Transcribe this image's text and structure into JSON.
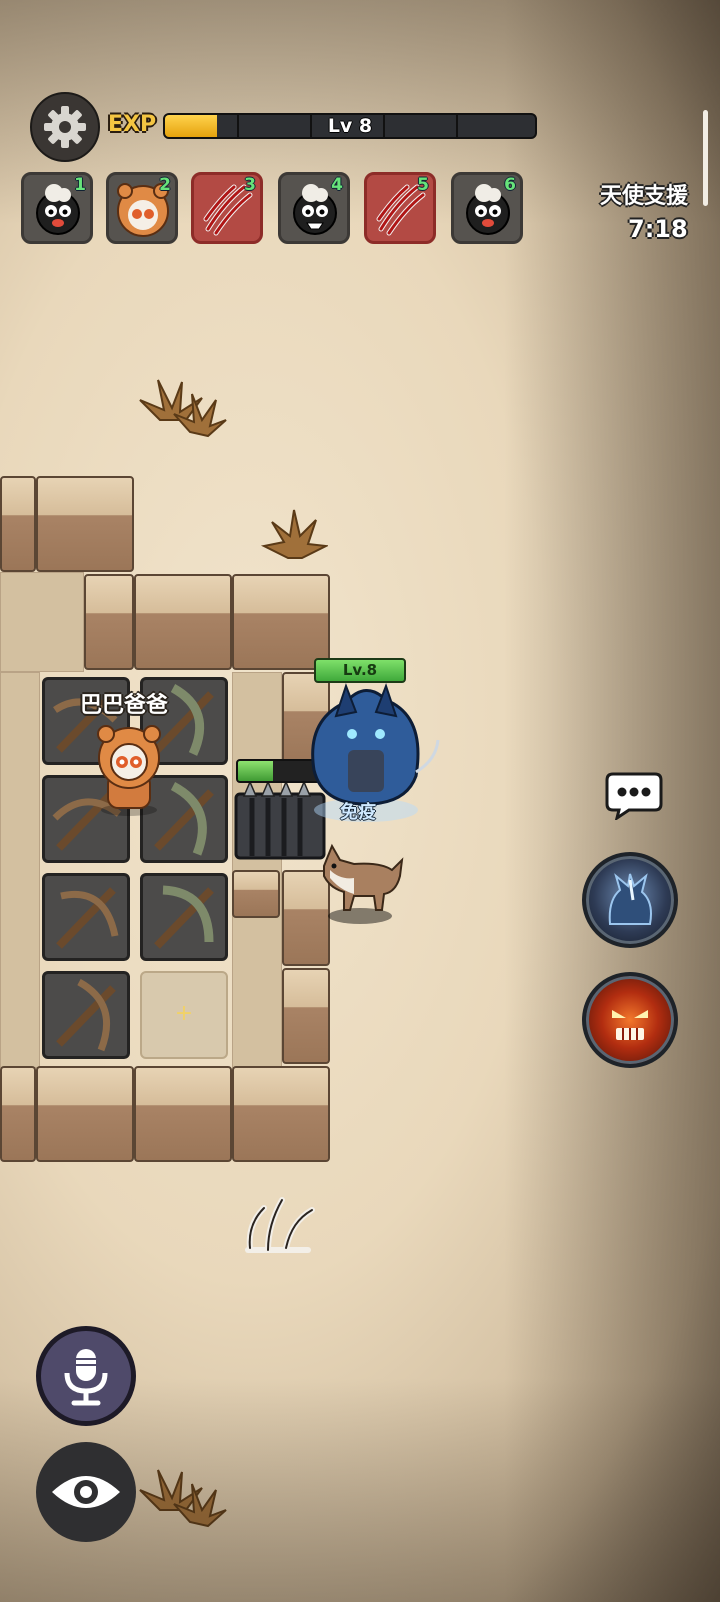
{
  "hud": {
    "exp_label": "EXP",
    "level_text": "Lv 8",
    "exp_progress": 0.14
  },
  "team": [
    {
      "num": "1",
      "icon": "black-sheep-icon",
      "highlight": false
    },
    {
      "num": "2",
      "icon": "tiger-hood-sheep-icon",
      "highlight": false
    },
    {
      "num": "3",
      "icon": "claw-slash-icon",
      "highlight": true
    },
    {
      "num": "4",
      "icon": "black-sheep-icon",
      "highlight": false
    },
    {
      "num": "5",
      "icon": "claw-slash-icon",
      "highlight": true
    },
    {
      "num": "6",
      "icon": "black-sheep-icon",
      "highlight": false
    }
  ],
  "support": {
    "label": "天使支援",
    "timer": "7:18"
  },
  "base": {
    "owner_name": "巴巴爸爸"
  },
  "enemy": {
    "level_tag": "Lv.8",
    "status_text": "免疫",
    "hp_fraction": 0.4
  },
  "colors": {
    "exp_fill": "#f0b92a",
    "hp_fill": "#5dbb45",
    "team_highlight": "#b34a44"
  }
}
